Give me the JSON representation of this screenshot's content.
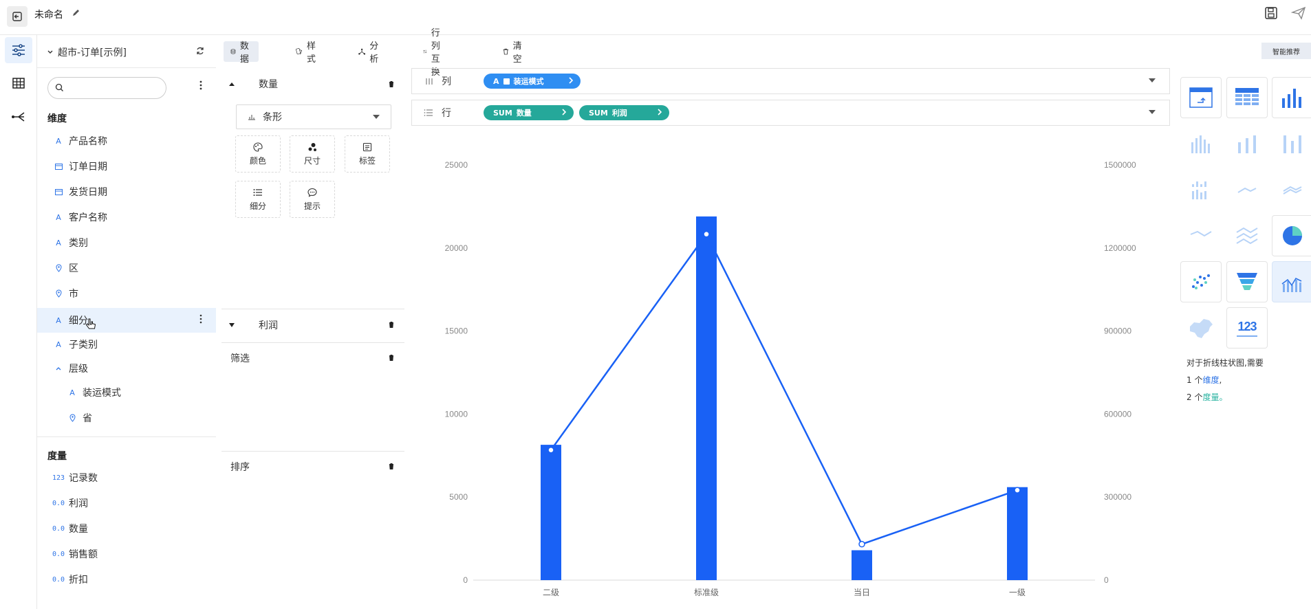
{
  "header": {
    "title": "未命名"
  },
  "fields_panel": {
    "datasource": "超市-订单[示例]",
    "search_placeholder": "",
    "dimensions_title": "维度",
    "dimensions": [
      {
        "label": "产品名称",
        "icon": "text-icon"
      },
      {
        "label": "订单日期",
        "icon": "calendar-icon"
      },
      {
        "label": "发货日期",
        "icon": "calendar-icon"
      },
      {
        "label": "客户名称",
        "icon": "text-icon"
      },
      {
        "label": "类别",
        "icon": "text-icon"
      },
      {
        "label": "区",
        "icon": "location-icon"
      },
      {
        "label": "市",
        "icon": "location-icon"
      },
      {
        "label": "细分",
        "icon": "text-icon"
      },
      {
        "label": "子类别",
        "icon": "text-icon"
      }
    ],
    "hierarchy": {
      "label": "层级",
      "children": [
        {
          "label": "装运模式",
          "icon": "text-icon"
        },
        {
          "label": "省",
          "icon": "location-icon"
        }
      ]
    },
    "measures_title": "度量",
    "measures": [
      {
        "label": "记录数",
        "icon": "123"
      },
      {
        "label": "利润",
        "icon": "0.0"
      },
      {
        "label": "数量",
        "icon": "0.0"
      },
      {
        "label": "销售额",
        "icon": "0.0"
      },
      {
        "label": "折扣",
        "icon": "0.0"
      }
    ]
  },
  "config_panel": {
    "tabs": [
      "数据",
      "样式",
      "分析",
      "行列互换",
      "清空"
    ],
    "measure1": "数量",
    "mark_type": "条形",
    "tiles": [
      "颜色",
      "尺寸",
      "标签",
      "细分",
      "提示"
    ],
    "measure2": "利润",
    "filter_label": "筛选",
    "sort_label": "排序"
  },
  "shelves": {
    "columns_label": "列",
    "rows_label": "行",
    "column_pill": "装运模式",
    "row_pills": [
      {
        "agg": "SUM",
        "field": "数量"
      },
      {
        "agg": "SUM",
        "field": "利润"
      }
    ]
  },
  "right_panel": {
    "smart_button": "智能推荐",
    "hint_line1": "对于折线柱状图,需要",
    "hint_line2_pre": "1 个",
    "hint_line2_link": "维度",
    "hint_line2_post": ",",
    "hint_line3_pre": "2 个",
    "hint_line3_link": "度量",
    "hint_line3_post": "。",
    "kpi_label": "123"
  },
  "chart_data": {
    "type": "bar",
    "combo": "bar-line",
    "categories": [
      "二级",
      "标准级",
      "当日",
      "一级"
    ],
    "series": [
      {
        "kind": "bar",
        "axis": "left",
        "values": [
          8150,
          21900,
          1800,
          5600
        ]
      },
      {
        "kind": "line",
        "axis": "right",
        "values": [
          470000,
          1250000,
          130000,
          325000
        ]
      }
    ],
    "left_ticks": [
      "25000",
      "20000",
      "15000",
      "10000",
      "5000",
      "0"
    ],
    "right_ticks": [
      "1500000",
      "1200000",
      "900000",
      "600000",
      "300000",
      "0"
    ],
    "ylim_left": [
      0,
      25000
    ],
    "ylim_right": [
      0,
      1500000
    ],
    "colors": {
      "bar": "#1961f5",
      "line": "#1961f5"
    }
  }
}
